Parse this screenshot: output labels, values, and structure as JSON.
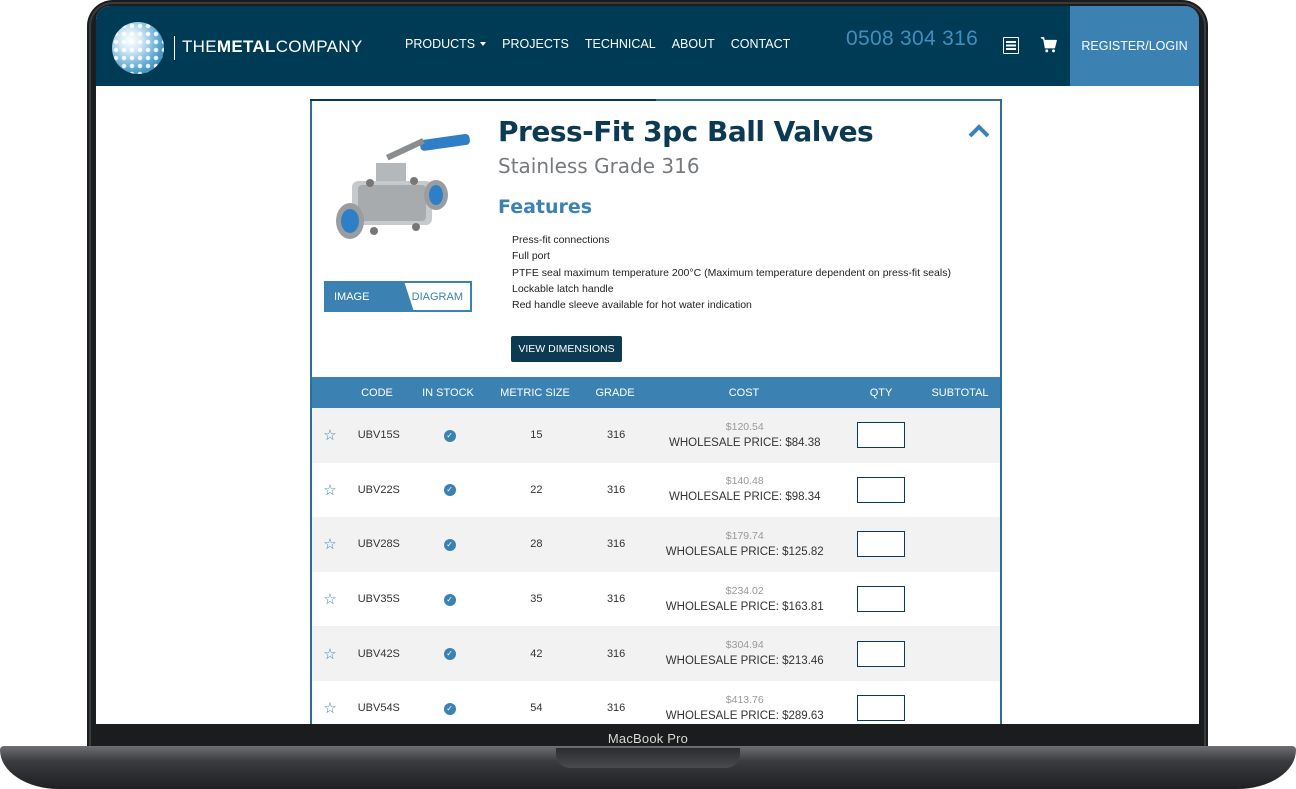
{
  "device": {
    "brand_label": "MacBook Pro"
  },
  "header": {
    "logo_text_1": "THE",
    "logo_text_2": "METAL",
    "logo_text_3": "COMPANY",
    "nav": [
      "PRODUCTS",
      "PROJECTS",
      "TECHNICAL",
      "ABOUT",
      "CONTACT"
    ],
    "phone": "0508 304 316",
    "register_label": "REGISTER/LOGIN"
  },
  "product": {
    "title": "Press-Fit 3pc Ball Valves",
    "subtitle": "Stainless Grade 316",
    "features_heading": "Features",
    "features": [
      "Press-fit connections",
      "Full port",
      "PTFE seal maximum temperature 200°C (Maximum temperature dependent on press-fit seals)",
      "Lockable latch handle",
      "Red handle sleeve available for hot water indication"
    ],
    "toggle_image": "IMAGE",
    "toggle_diagram": "DIAGRAM",
    "dimensions_button": "VIEW DIMENSIONS"
  },
  "table": {
    "headers": [
      "CODE",
      "IN STOCK",
      "METRIC SIZE",
      "GRADE",
      "COST",
      "QTY",
      "SUBTOTAL"
    ],
    "rows": [
      {
        "code": "UBV15S",
        "size": "15",
        "grade": "316",
        "cost": "$120.54",
        "wholesale_label": "WHOLESALE PRICE: ",
        "wholesale": "$84.38"
      },
      {
        "code": "UBV22S",
        "size": "22",
        "grade": "316",
        "cost": "$140.48",
        "wholesale_label": "WHOLESALE PRICE: ",
        "wholesale": "$98.34"
      },
      {
        "code": "UBV28S",
        "size": "28",
        "grade": "316",
        "cost": "$179.74",
        "wholesale_label": "WHOLESALE PRICE: ",
        "wholesale": "$125.82"
      },
      {
        "code": "UBV35S",
        "size": "35",
        "grade": "316",
        "cost": "$234.02",
        "wholesale_label": "WHOLESALE PRICE: ",
        "wholesale": "$163.81"
      },
      {
        "code": "UBV42S",
        "size": "42",
        "grade": "316",
        "cost": "$304.94",
        "wholesale_label": "WHOLESALE PRICE: ",
        "wholesale": "$213.46"
      },
      {
        "code": "UBV54S",
        "size": "54",
        "grade": "316",
        "cost": "$413.76",
        "wholesale_label": "WHOLESALE PRICE: ",
        "wholesale": "$289.63"
      }
    ]
  },
  "colors": {
    "navy": "#003b55",
    "accent": "#3b82b3",
    "phone": "#3d8fbf"
  }
}
